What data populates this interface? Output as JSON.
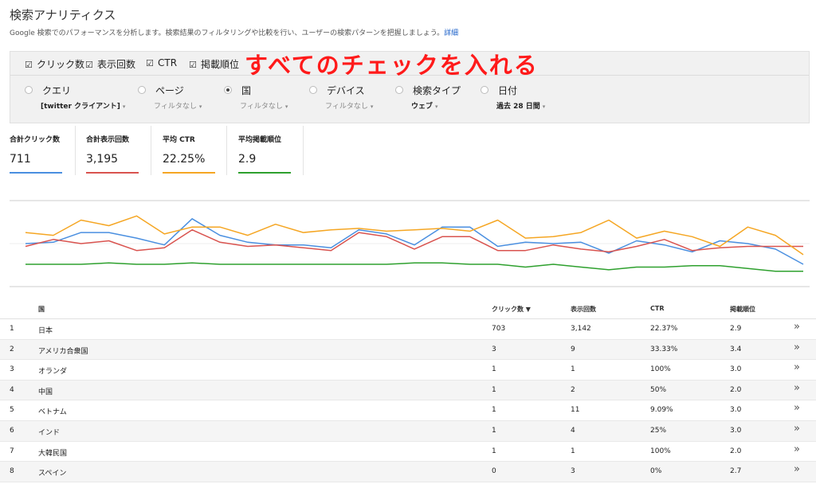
{
  "header": {
    "title": "検索アナリティクス",
    "description": "Google 検索でのパフォーマンスを分析します。検索結果のフィルタリングや比較を行い、ユーザーの検索パターンを把握しましょう。",
    "details_link": "詳細"
  },
  "metric_checks": [
    {
      "label": "クリック数",
      "checked": true
    },
    {
      "label": "表示回数",
      "checked": true
    },
    {
      "label": "CTR",
      "checked": true
    },
    {
      "label": "掲載順位",
      "checked": true
    }
  ],
  "annotation": "すべてのチェックを入れる",
  "dimensions": [
    {
      "label": "クエリ",
      "value": "[twitter クライアント]",
      "selected": false
    },
    {
      "label": "ページ",
      "value": "フィルタなし",
      "selected": false
    },
    {
      "label": "国",
      "value": "フィルタなし",
      "selected": true
    },
    {
      "label": "デバイス",
      "value": "フィルタなし",
      "selected": false
    },
    {
      "label": "検索タイプ",
      "value": "ウェブ",
      "selected": false
    },
    {
      "label": "日付",
      "value": "過去 28 日間",
      "selected": false
    }
  ],
  "caret": "▾",
  "totals": [
    {
      "label": "合計クリック数",
      "value": "711",
      "color": "#4a8fe0"
    },
    {
      "label": "合計表示回数",
      "value": "3,195",
      "color": "#d9534f"
    },
    {
      "label": "平均 CTR",
      "value": "22.25%",
      "color": "#f5a623"
    },
    {
      "label": "平均掲載順位",
      "value": "2.9",
      "color": "#2ea02e"
    }
  ],
  "chart_data": {
    "type": "line",
    "grid": true,
    "series": [
      {
        "name": "クリック数",
        "color": "#4a8fe0",
        "values": [
          30,
          29,
          22,
          22,
          26,
          31,
          12,
          24,
          29,
          31,
          31,
          33,
          20,
          23,
          31,
          18,
          18,
          32,
          29,
          30,
          29,
          37,
          28,
          31,
          36,
          28,
          30,
          34,
          45
        ]
      },
      {
        "name": "表示回数",
        "color": "#d9534f",
        "values": [
          32,
          27,
          30,
          28,
          35,
          33,
          20,
          29,
          32,
          31,
          33,
          35,
          22,
          25,
          34,
          25,
          25,
          35,
          35,
          31,
          34,
          36,
          32,
          27,
          35,
          33,
          32,
          32,
          32
        ]
      },
      {
        "name": "CTR",
        "color": "#f5a623",
        "values": [
          22,
          24,
          13,
          17,
          10,
          23,
          18,
          18,
          24,
          16,
          22,
          20,
          19,
          21,
          20,
          19,
          21,
          13,
          26,
          25,
          22,
          13,
          26,
          21,
          25,
          32,
          18,
          24,
          38
        ]
      },
      {
        "name": "掲載順位",
        "color": "#2ea02e",
        "values": [
          45,
          45,
          45,
          44,
          45,
          45,
          44,
          45,
          45,
          45,
          45,
          45,
          45,
          45,
          44,
          44,
          45,
          45,
          47,
          45,
          47,
          49,
          47,
          47,
          46,
          46,
          48,
          50,
          50
        ]
      }
    ]
  },
  "table": {
    "columns": [
      "国",
      "クリック数 ▼",
      "表示回数",
      "CTR",
      "掲載順位"
    ],
    "rows": [
      {
        "rank": "1",
        "country": "日本",
        "clicks": "703",
        "impressions": "3,142",
        "ctr": "22.37%",
        "position": "2.9"
      },
      {
        "rank": "2",
        "country": "アメリカ合衆国",
        "clicks": "3",
        "impressions": "9",
        "ctr": "33.33%",
        "position": "3.4"
      },
      {
        "rank": "3",
        "country": "オランダ",
        "clicks": "1",
        "impressions": "1",
        "ctr": "100%",
        "position": "3.0"
      },
      {
        "rank": "4",
        "country": "中国",
        "clicks": "1",
        "impressions": "2",
        "ctr": "50%",
        "position": "2.0"
      },
      {
        "rank": "5",
        "country": "ベトナム",
        "clicks": "1",
        "impressions": "11",
        "ctr": "9.09%",
        "position": "3.0"
      },
      {
        "rank": "6",
        "country": "インド",
        "clicks": "1",
        "impressions": "4",
        "ctr": "25%",
        "position": "3.0"
      },
      {
        "rank": "7",
        "country": "大韓民国",
        "clicks": "1",
        "impressions": "1",
        "ctr": "100%",
        "position": "2.0"
      },
      {
        "rank": "8",
        "country": "スペイン",
        "clicks": "0",
        "impressions": "3",
        "ctr": "0%",
        "position": "2.7"
      }
    ],
    "row_action": "»"
  }
}
